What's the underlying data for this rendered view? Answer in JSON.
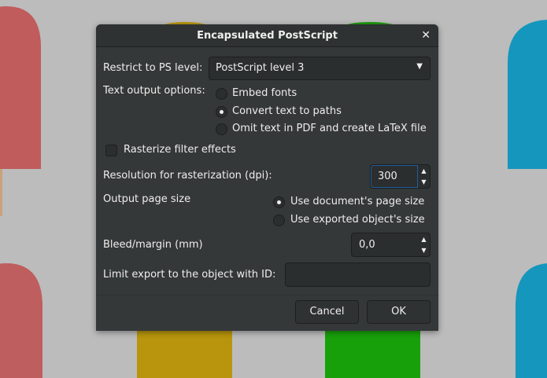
{
  "dialog": {
    "title": "Encapsulated PostScript",
    "close_icon": "close-icon"
  },
  "ps_level": {
    "label": "Restrict to PS level:",
    "value": "PostScript level 3"
  },
  "text_output": {
    "label": "Text output options:",
    "options": [
      "Embed fonts",
      "Convert text to paths",
      "Omit text in PDF and create LaTeX file"
    ],
    "selected": 1
  },
  "rasterize": {
    "label": "Rasterize filter effects",
    "checked": false
  },
  "resolution": {
    "label": "Resolution for rasterization (dpi):",
    "value": "300"
  },
  "page_size": {
    "label": "Output page size",
    "options": [
      "Use document's page size",
      "Use exported object's size"
    ],
    "selected": 0
  },
  "bleed": {
    "label": "Bleed/margin (mm)",
    "value": "0,0"
  },
  "limit_id": {
    "label": "Limit export to the object with ID:",
    "value": ""
  },
  "buttons": {
    "cancel": "Cancel",
    "ok": "OK"
  },
  "colors": {
    "accent": "#215d9c",
    "dialog_bg": "#353839",
    "desktop": "#bcbcbc"
  }
}
